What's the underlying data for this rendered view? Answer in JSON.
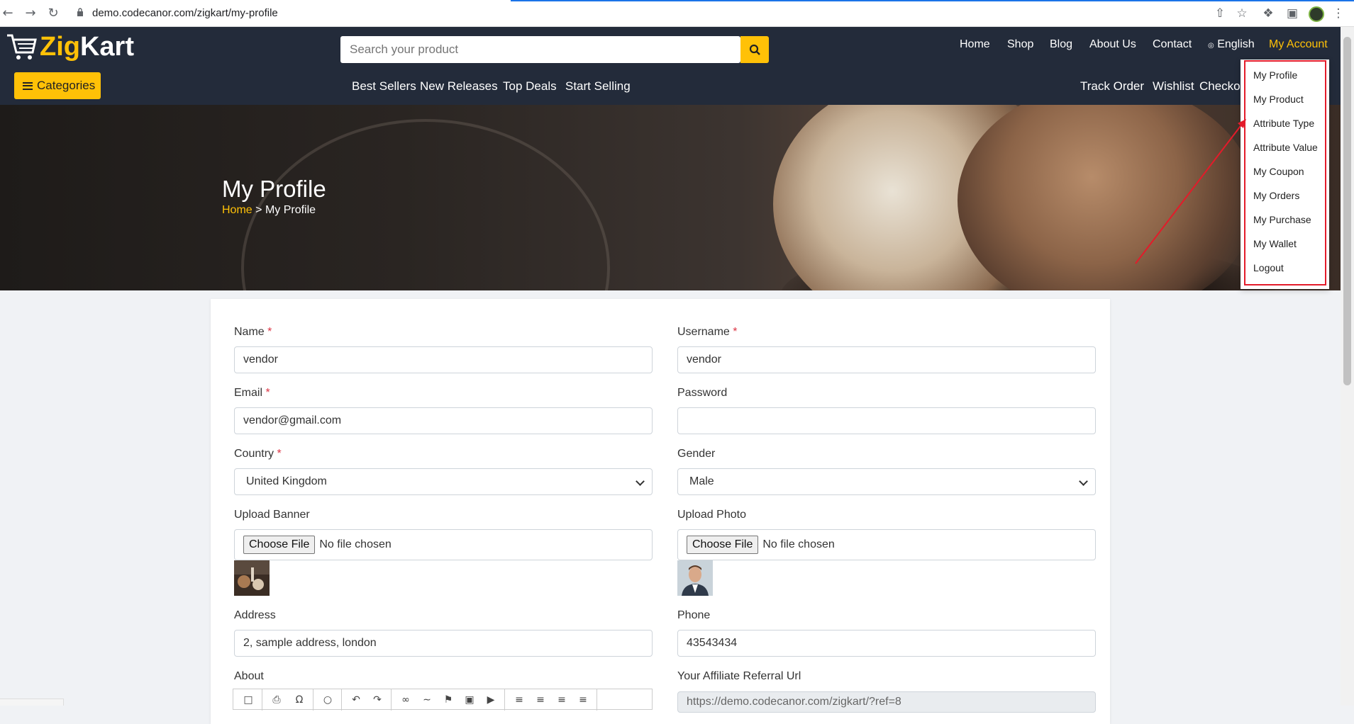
{
  "browser": {
    "url": "demo.codecanor.com/zigkart/my-profile",
    "icons": [
      "back-icon",
      "forward-icon",
      "reload-icon",
      "lock-icon",
      "share-icon",
      "star-icon",
      "extension-icon",
      "sidepanel-icon",
      "profile-avatar",
      "kebab-menu-icon"
    ]
  },
  "header": {
    "logo_text_a": "Zig",
    "logo_text_b": "Kart",
    "search_placeholder": "Search your product",
    "top_menu": [
      "Home",
      "Shop",
      "Blog",
      "About Us",
      "Contact",
      "English",
      "My Account"
    ],
    "categories_label": "Categories",
    "sub_menu": [
      "Best Sellers",
      "New Releases",
      "Top Deals",
      "Start Selling"
    ],
    "right_menu": [
      "Track Order",
      "Wishlist",
      "Checkout"
    ],
    "accent": "#ffc107",
    "bg": "#232b3a"
  },
  "hero": {
    "title": "My Profile",
    "crumb_home": "Home",
    "crumb_sep": ">",
    "crumb_current": "My Profile"
  },
  "account_menu": {
    "items": [
      "My Profile",
      "My Product",
      "Attribute Type",
      "Attribute Value",
      "My Coupon",
      "My Orders",
      "My Purchase",
      "My Wallet",
      "Logout"
    ],
    "highlight_color": "#e31b2a"
  },
  "form": {
    "name_label": "Name",
    "name_value": "vendor",
    "username_label": "Username",
    "username_value": "vendor",
    "email_label": "Email",
    "email_value": "vendor@gmail.com",
    "password_label": "Password",
    "password_value": "",
    "country_label": "Country",
    "country_value": "United Kingdom",
    "gender_label": "Gender",
    "gender_value": "Male",
    "upload_banner_label": "Upload Banner",
    "upload_photo_label": "Upload Photo",
    "choose_file": "Choose File",
    "no_file": "No file chosen",
    "address_label": "Address",
    "address_value": "2, sample address, london",
    "phone_label": "Phone",
    "phone_value": "43543434",
    "about_label": "About",
    "affiliate_label": "Your Affiliate Referral Url",
    "affiliate_value": "https://demo.codecanor.com/zigkart/?ref=8",
    "required_mark": "*"
  }
}
